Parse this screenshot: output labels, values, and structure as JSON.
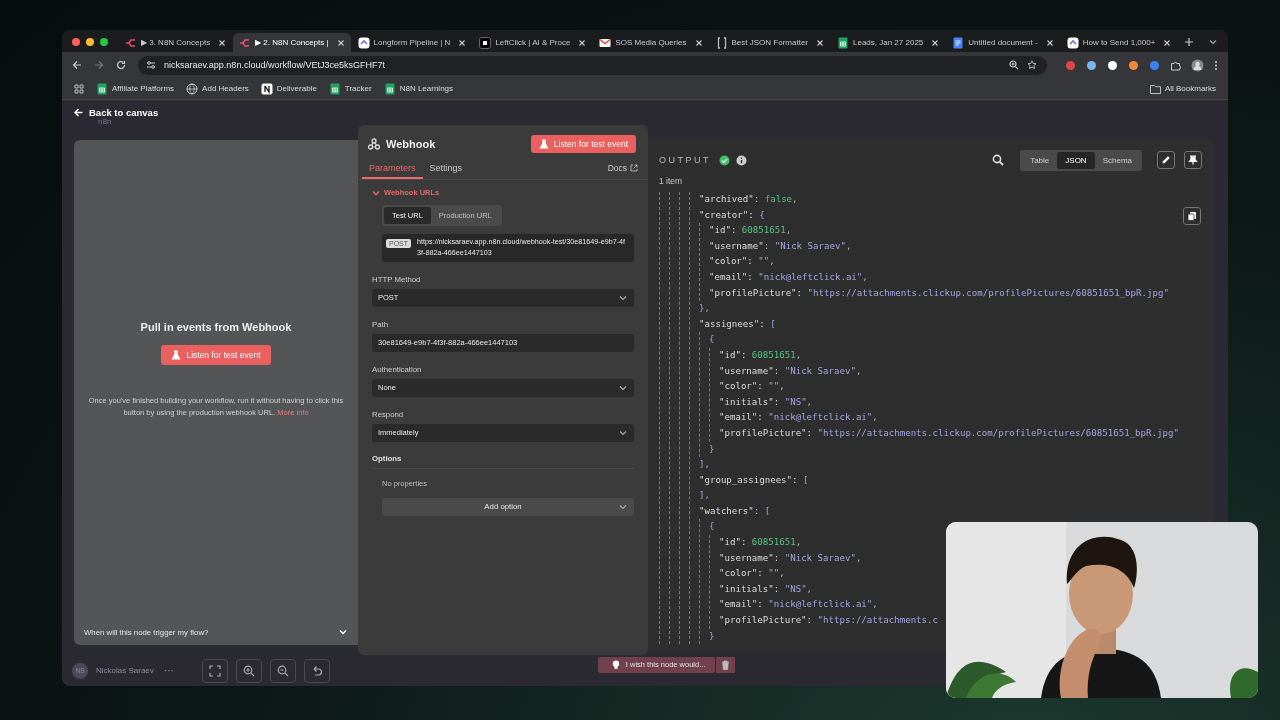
{
  "browser": {
    "tabs": [
      {
        "title": "▶ 3. N8N Concepts",
        "kind": "n8n",
        "selected": false
      },
      {
        "title": "▶ 2. N8N Concepts |",
        "kind": "n8n",
        "selected": true
      },
      {
        "title": "Longform Pipeline | N",
        "kind": "clickup",
        "selected": false
      },
      {
        "title": "LeftClick | AI & Proce",
        "kind": "leftclick",
        "selected": false
      },
      {
        "title": "SOS Media Queries",
        "kind": "gmail",
        "selected": false
      },
      {
        "title": "Best JSON Formatter",
        "kind": "json",
        "selected": false
      },
      {
        "title": "Leads, Jan 27 2025",
        "kind": "sheets",
        "selected": false
      },
      {
        "title": "Untitled document -",
        "kind": "docs",
        "selected": false
      },
      {
        "title": "How to Send 1,000+",
        "kind": "clickup",
        "selected": false
      }
    ],
    "address": "nicksaraev.app.n8n.cloud/workflow/VEtJ3ce5ksGFHF7t",
    "bookmarks": [
      {
        "label": "Affiliate Platforms",
        "kind": "sheets"
      },
      {
        "label": "Add Headers",
        "kind": "globe"
      },
      {
        "label": "Deliverable",
        "kind": "notion"
      },
      {
        "label": "Tracker",
        "kind": "sheets"
      },
      {
        "label": "N8N Learnings",
        "kind": "sheets"
      }
    ],
    "all_bookmarks": "All Bookmarks"
  },
  "app": {
    "back_link": "Back to canvas",
    "logo_text": "n8n",
    "trigger_panel": {
      "title": "Pull in events from Webhook",
      "button": "Listen for test event",
      "hint": "Once you've finished building your workflow, run it without having to click this button by using the production webhook URL.",
      "hint_link": "More info",
      "question": "When will this node trigger my flow?"
    },
    "node_panel": {
      "title": "Webhook",
      "listen_button": "Listen for test event",
      "tabs": [
        {
          "label": "Parameters",
          "selected": true
        },
        {
          "label": "Settings",
          "selected": false
        }
      ],
      "docs_link": "Docs",
      "webhook_urls": {
        "label": "Webhook URLs",
        "expanded": true,
        "toggle": [
          {
            "label": "Test URL",
            "selected": true
          },
          {
            "label": "Production URL",
            "selected": false
          }
        ],
        "method": "POST",
        "url": "https://nicksaraev.app.n8n.cloud/webhook-test/30e81649-e9b7-4f3f-882a-466ee1447103"
      },
      "fields": [
        {
          "label": "HTTP Method",
          "value": "POST",
          "kind": "select"
        },
        {
          "label": "Path",
          "value": "30e81649-e9b7-4f3f-882a-466ee1447103",
          "kind": "input"
        },
        {
          "label": "Authentication",
          "value": "None",
          "kind": "select"
        },
        {
          "label": "Respond",
          "value": "Immediately",
          "kind": "select"
        }
      ],
      "options": {
        "label": "Options",
        "empty_text": "No properties",
        "add_button": "Add option"
      }
    },
    "output": {
      "label": "OUTPUT",
      "views": [
        {
          "label": "Table",
          "selected": false
        },
        {
          "label": "JSON",
          "selected": true
        },
        {
          "label": "Schema",
          "selected": false
        }
      ],
      "item_count": "1 item",
      "json_lines": [
        {
          "children": [
            {
              "children": [
                {
                  "children": [
                    {
                      "children": [
                        {
                          "key": "\"archived\":",
                          "value": "false",
                          "kind": "bool",
                          "tail": ","
                        },
                        {
                          "key": "\"creator\":",
                          "value": "{",
                          "kind": "bracket",
                          "children": [
                            {
                              "key": "\"id\":",
                              "value": "60851651",
                              "kind": "number",
                              "tail": ","
                            },
                            {
                              "key": "\"username\":",
                              "value": "\"Nick Saraev\"",
                              "kind": "string",
                              "tail": ","
                            },
                            {
                              "key": "\"color\":",
                              "value": "\"\"",
                              "kind": "string",
                              "tail": ","
                            },
                            {
                              "key": "\"email\":",
                              "value": "\"nick@leftclick.ai\"",
                              "kind": "string",
                              "tail": ","
                            },
                            {
                              "key": "\"profilePicture\":",
                              "value": "\"https://attachments.clickup.com/profilePictures/60851651_bpR.jpg\"",
                              "kind": "string"
                            }
                          ],
                          "close": "},"
                        },
                        {
                          "key": "\"assignees\":",
                          "value": "[",
                          "kind": "bracket",
                          "children": [
                            {
                              "value": "{",
                              "kind": "bracket",
                              "children": [
                                {
                                  "key": "\"id\":",
                                  "value": "60851651",
                                  "kind": "number",
                                  "tail": ","
                                },
                                {
                                  "key": "\"username\":",
                                  "value": "\"Nick Saraev\"",
                                  "kind": "string",
                                  "tail": ","
                                },
                                {
                                  "key": "\"color\":",
                                  "value": "\"\"",
                                  "kind": "string",
                                  "tail": ","
                                },
                                {
                                  "key": "\"initials\":",
                                  "value": "\"NS\"",
                                  "kind": "string",
                                  "tail": ","
                                },
                                {
                                  "key": "\"email\":",
                                  "value": "\"nick@leftclick.ai\"",
                                  "kind": "string",
                                  "tail": ","
                                },
                                {
                                  "key": "\"profilePicture\":",
                                  "value": "\"https://attachments.clickup.com/profilePictures/60851651_bpR.jpg\"",
                                  "kind": "string"
                                }
                              ],
                              "close": "}"
                            }
                          ],
                          "close": "],"
                        },
                        {
                          "key": "\"group_assignees\":",
                          "value": "[",
                          "kind": "bracket",
                          "close": "],"
                        },
                        {
                          "key": "\"watchers\":",
                          "value": "[",
                          "kind": "bracket",
                          "children": [
                            {
                              "value": "{",
                              "kind": "bracket",
                              "children": [
                                {
                                  "key": "\"id\":",
                                  "value": "60851651",
                                  "kind": "number",
                                  "tail": ","
                                },
                                {
                                  "key": "\"username\":",
                                  "value": "\"Nick Saraev\"",
                                  "kind": "string",
                                  "tail": ","
                                },
                                {
                                  "key": "\"color\":",
                                  "value": "\"\"",
                                  "kind": "string",
                                  "tail": ","
                                },
                                {
                                  "key": "\"initials\":",
                                  "value": "\"NS\"",
                                  "kind": "string",
                                  "tail": ","
                                },
                                {
                                  "key": "\"email\":",
                                  "value": "\"nick@leftclick.ai\"",
                                  "kind": "string",
                                  "tail": ","
                                },
                                {
                                  "key": "\"profilePicture\":",
                                  "value": "\"https://attachments.c",
                                  "kind": "string"
                                }
                              ],
                              "close": "}"
                            }
                          ]
                        }
                      ]
                    }
                  ]
                }
              ]
            }
          ]
        }
      ]
    },
    "footer": {
      "initials": "NS",
      "user_name": "Nickolas Saraev",
      "more": "···",
      "feedback": "I wish this node would..."
    }
  }
}
